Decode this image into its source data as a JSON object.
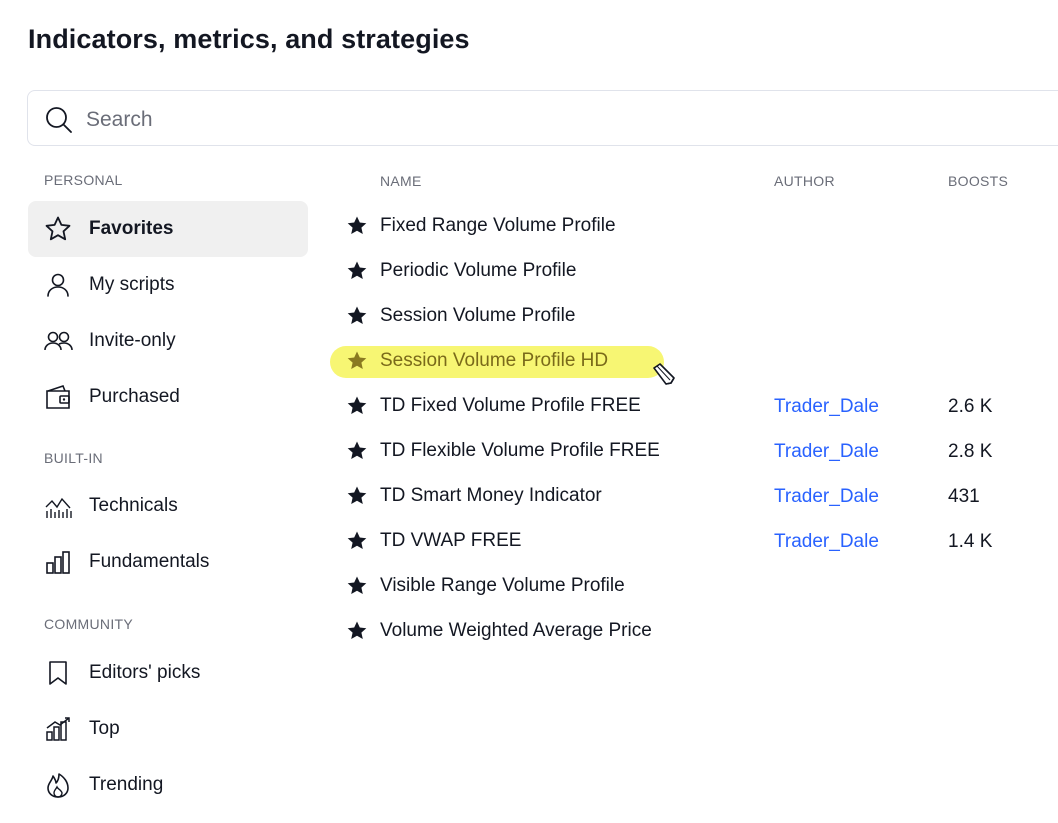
{
  "page": {
    "title": "Indicators, metrics, and strategies"
  },
  "search": {
    "placeholder": "Search"
  },
  "sidebar": {
    "sections": [
      {
        "label": "PERSONAL"
      },
      {
        "label": "BUILT-IN"
      },
      {
        "label": "COMMUNITY"
      }
    ],
    "items": [
      {
        "label": "Favorites",
        "icon": "star-outline-icon",
        "active": true
      },
      {
        "label": "My scripts",
        "icon": "user-icon"
      },
      {
        "label": "Invite-only",
        "icon": "users-icon"
      },
      {
        "label": "Purchased",
        "icon": "wallet-icon"
      },
      {
        "label": "Technicals",
        "icon": "technicals-icon"
      },
      {
        "label": "Fundamentals",
        "icon": "fundamentals-icon"
      },
      {
        "label": "Editors' picks",
        "icon": "bookmark-icon"
      },
      {
        "label": "Top",
        "icon": "top-chart-icon"
      },
      {
        "label": "Trending",
        "icon": "flame-icon"
      }
    ]
  },
  "table": {
    "headers": {
      "name": "NAME",
      "author": "AUTHOR",
      "boosts": "BOOSTS"
    },
    "rows": [
      {
        "name": "Fixed Range Volume Profile",
        "author": "",
        "boosts": ""
      },
      {
        "name": "Periodic Volume Profile",
        "author": "",
        "boosts": ""
      },
      {
        "name": "Session Volume Profile",
        "author": "",
        "boosts": ""
      },
      {
        "name": "Session Volume Profile HD",
        "author": "",
        "boosts": "",
        "highlighted": true
      },
      {
        "name": "TD Fixed Volume Profile FREE",
        "author": "Trader_Dale",
        "boosts": "2.6 K"
      },
      {
        "name": "TD Flexible Volume Profile FREE",
        "author": "Trader_Dale",
        "boosts": "2.8 K"
      },
      {
        "name": "TD Smart Money Indicator",
        "author": "Trader_Dale",
        "boosts": "431"
      },
      {
        "name": "TD VWAP FREE",
        "author": "Trader_Dale",
        "boosts": "1.4 K"
      },
      {
        "name": "Visible Range Volume Profile",
        "author": "",
        "boosts": ""
      },
      {
        "name": "Volume Weighted Average Price",
        "author": "",
        "boosts": ""
      }
    ]
  },
  "colors": {
    "accent_link": "#2962ff",
    "highlight": "#f6f45a",
    "active_bg": "#f0f0f0"
  }
}
